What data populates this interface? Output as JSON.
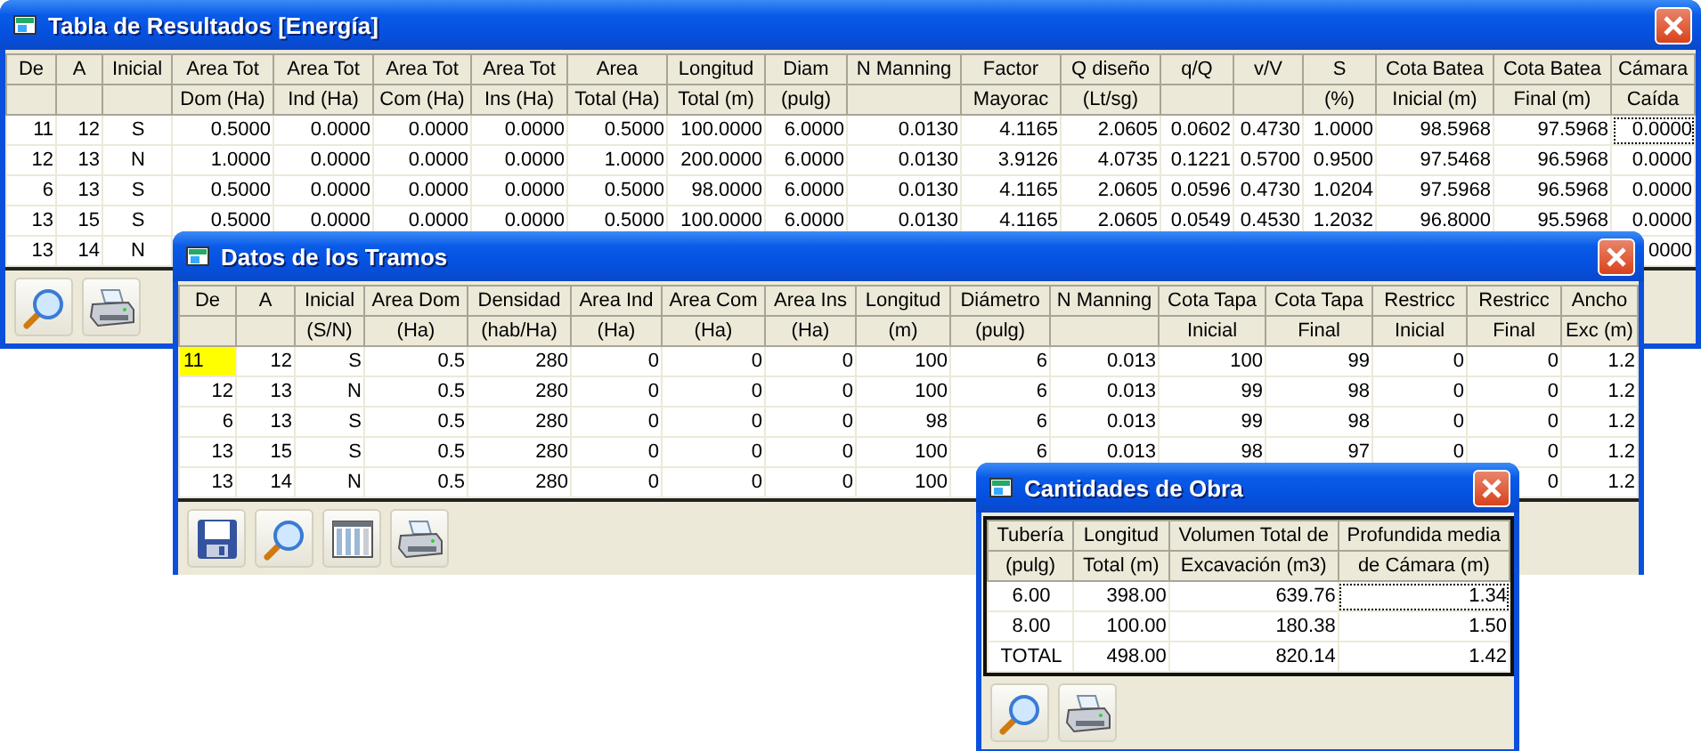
{
  "windows": [
    {
      "title": "Tabla de Resultados [Energía]",
      "table": {
        "columns": [
          {
            "line1": "De"
          },
          {
            "line1": "A"
          },
          {
            "line1": "Inicial"
          },
          {
            "line1": "Area Tot",
            "line2": "Dom (Ha)"
          },
          {
            "line1": "Area Tot",
            "line2": "Ind (Ha)"
          },
          {
            "line1": "Area Tot",
            "line2": "Com (Ha)"
          },
          {
            "line1": "Area Tot",
            "line2": "Ins (Ha)"
          },
          {
            "line1": "Area",
            "line2": "Total (Ha)"
          },
          {
            "line1": "Longitud",
            "line2": "Total (m)"
          },
          {
            "line1": "Diam",
            "line2": "(pulg)"
          },
          {
            "line1": "N Manning"
          },
          {
            "line1": "Factor",
            "line2": "Mayorac"
          },
          {
            "line1": "Q diseño",
            "line2": "(Lt/sg)"
          },
          {
            "line1": "q/Q"
          },
          {
            "line1": "v/V"
          },
          {
            "line1": "S",
            "line2": "(%)"
          },
          {
            "line1": "Cota Batea",
            "line2": "Inicial (m)"
          },
          {
            "line1": "Cota Batea",
            "line2": "Final (m)"
          },
          {
            "line1": "Cámara",
            "line2": "Caída"
          }
        ],
        "rows": [
          {
            "cells": [
              "11",
              "12",
              "S",
              "0.5000",
              "0.0000",
              "0.0000",
              "0.0000",
              "0.5000",
              "100.0000",
              "6.0000",
              "0.0130",
              "4.1165",
              "2.0605",
              "0.0602",
              "0.4730",
              "1.0000",
              "98.5968",
              "97.5968",
              "0.0000"
            ],
            "highlighted": false,
            "focused": true
          },
          {
            "cells": [
              "12",
              "13",
              "N",
              "1.0000",
              "0.0000",
              "0.0000",
              "0.0000",
              "1.0000",
              "200.0000",
              "6.0000",
              "0.0130",
              "3.9126",
              "4.0735",
              "0.1221",
              "0.5700",
              "0.9500",
              "97.5468",
              "96.5968",
              "0.0000"
            ],
            "highlighted": false,
            "focused": false
          },
          {
            "cells": [
              "6",
              "13",
              "S",
              "0.5000",
              "0.0000",
              "0.0000",
              "0.0000",
              "0.5000",
              "98.0000",
              "6.0000",
              "0.0130",
              "4.1165",
              "2.0605",
              "0.0596",
              "0.4730",
              "1.0204",
              "97.5968",
              "96.5968",
              "0.0000"
            ],
            "highlighted": false,
            "focused": false
          },
          {
            "cells": [
              "13",
              "15",
              "S",
              "0.5000",
              "0.0000",
              "0.0000",
              "0.0000",
              "0.5000",
              "100.0000",
              "6.0000",
              "0.0130",
              "4.1165",
              "2.0605",
              "0.0549",
              "0.4530",
              "1.2032",
              "96.8000",
              "95.5968",
              "0.0000"
            ],
            "highlighted": false,
            "focused": false
          },
          {
            "cells": [
              "13",
              "14",
              "N",
              null,
              null,
              null,
              null,
              null,
              null,
              null,
              null,
              null,
              null,
              null,
              null,
              null,
              null,
              null,
              "0000"
            ],
            "highlighted": false,
            "focused": false
          }
        ]
      },
      "buttons": [
        {
          "kind": "search"
        },
        {
          "kind": "print"
        }
      ]
    },
    {
      "title": "Datos de los Tramos",
      "table": {
        "columns": [
          {
            "line1": "De"
          },
          {
            "line1": "A"
          },
          {
            "line1": "Inicial",
            "line2": "(S/N)"
          },
          {
            "line1": "Area Dom",
            "line2": "(Ha)"
          },
          {
            "line1": "Densidad",
            "line2": "(hab/Ha)"
          },
          {
            "line1": "Area Ind",
            "line2": "(Ha)"
          },
          {
            "line1": "Area Com",
            "line2": "(Ha)"
          },
          {
            "line1": "Area Ins",
            "line2": "(Ha)"
          },
          {
            "line1": "Longitud",
            "line2": "(m)"
          },
          {
            "line1": "Diámetro",
            "line2": "(pulg)"
          },
          {
            "line1": "N Manning"
          },
          {
            "line1": "Cota Tapa",
            "line2": "Inicial"
          },
          {
            "line1": "Cota Tapa",
            "line2": "Final"
          },
          {
            "line1": "Restricc",
            "line2": "Inicial"
          },
          {
            "line1": "Restricc",
            "line2": "Final"
          },
          {
            "line1": "Ancho",
            "line2": "Exc (m)"
          }
        ],
        "rows": [
          {
            "cells": [
              "11",
              "12",
              "S",
              "0.5",
              "280",
              "0",
              "0",
              "0",
              "100",
              "6",
              "0.013",
              "100",
              "99",
              "0",
              "0",
              "1.2"
            ],
            "highlighted": true,
            "focused": false
          },
          {
            "cells": [
              "12",
              "13",
              "N",
              "0.5",
              "280",
              "0",
              "0",
              "0",
              "100",
              "6",
              "0.013",
              "99",
              "98",
              "0",
              "0",
              "1.2"
            ],
            "highlighted": false,
            "focused": false
          },
          {
            "cells": [
              "6",
              "13",
              "S",
              "0.5",
              "280",
              "0",
              "0",
              "0",
              "98",
              "6",
              "0.013",
              "99",
              "98",
              "0",
              "0",
              "1.2"
            ],
            "highlighted": false,
            "focused": false
          },
          {
            "cells": [
              "13",
              "15",
              "S",
              "0.5",
              "280",
              "0",
              "0",
              "0",
              "100",
              "6",
              "0.013",
              "98",
              "97",
              "0",
              "0",
              "1.2"
            ],
            "highlighted": false,
            "focused": false
          },
          {
            "cells": [
              "13",
              "14",
              "N",
              "0.5",
              "280",
              "0",
              "0",
              "0",
              "100",
              null,
              null,
              null,
              null,
              null,
              "0",
              "1.2"
            ],
            "highlighted": false,
            "focused": false
          }
        ]
      },
      "buttons": [
        {
          "kind": "save"
        },
        {
          "kind": "search"
        },
        {
          "kind": "columns"
        },
        {
          "kind": "print"
        }
      ]
    },
    {
      "title": "Cantidades de Obra",
      "table": {
        "columns": [
          {
            "line1": "Tubería",
            "line2": "(pulg)"
          },
          {
            "line1": "Longitud",
            "line2": "Total (m)"
          },
          {
            "line1": "Volumen Total de",
            "line2": "Excavación (m3)"
          },
          {
            "line1": "Profundida media",
            "line2": "de Cámara (m)"
          }
        ],
        "rows": [
          {
            "cells": [
              "6.00",
              "398.00",
              "639.76",
              "1.34"
            ],
            "highlighted": false,
            "focused": true
          },
          {
            "cells": [
              "8.00",
              "100.00",
              "180.38",
              "1.50"
            ],
            "highlighted": false,
            "focused": false
          },
          {
            "cells": [
              "TOTAL",
              "498.00",
              "820.14",
              "1.42"
            ],
            "highlighted": false,
            "focused": false
          }
        ]
      },
      "buttons": [
        {
          "kind": "search"
        },
        {
          "kind": "print"
        }
      ]
    }
  ]
}
